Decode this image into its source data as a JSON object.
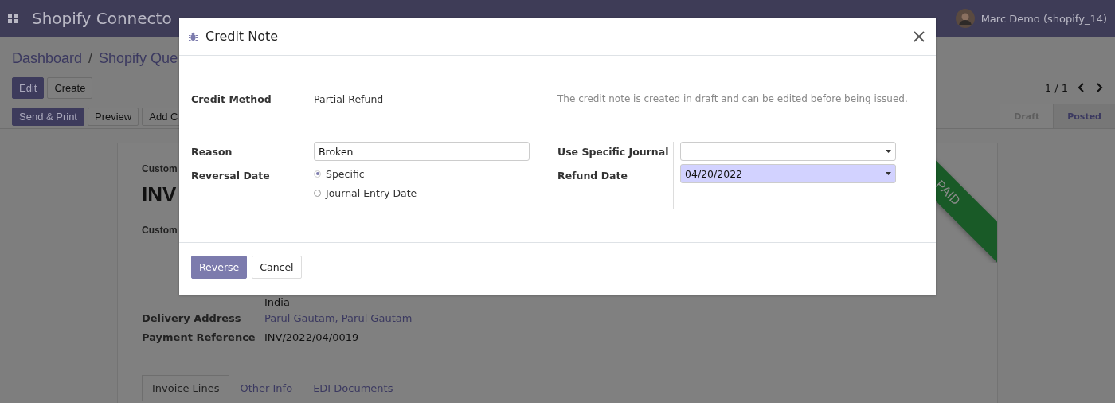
{
  "navbar": {
    "app_title": "Shopify Connecto",
    "user": "Marc Demo (shopify_14)"
  },
  "breadcrumb": {
    "link": "Dashboard",
    "separator": "/",
    "current": "Shopify Que"
  },
  "control_panel": {
    "buttons": [
      {
        "label": "Edit",
        "kind": "primary"
      },
      {
        "label": "Create",
        "kind": "secondary"
      }
    ],
    "pager": "1 / 1"
  },
  "status_bar": {
    "buttons": [
      {
        "label": "Send & Print",
        "kind": "primary"
      },
      {
        "label": "Preview",
        "kind": "secondary"
      },
      {
        "label": "Add C",
        "kind": "secondary"
      }
    ],
    "stages": [
      {
        "label": "Draft",
        "selected": false
      },
      {
        "label": "Posted",
        "selected": true
      }
    ]
  },
  "sheet": {
    "partner_label": "Custom",
    "title": "INV",
    "customer_label": "Custom",
    "address_line": "India",
    "fields": [
      {
        "label": "Delivery Address",
        "value": "Parul Gautam, Parul Gautam",
        "kind": "link"
      },
      {
        "label": "Payment Reference",
        "value": "INV/2022/04/0019",
        "kind": "text"
      }
    ],
    "ribbon": "PAID",
    "tabs": [
      {
        "label": "Invoice Lines",
        "selected": true
      },
      {
        "label": "Other Info",
        "selected": false
      },
      {
        "label": "EDI Documents",
        "selected": false
      }
    ]
  },
  "dialog": {
    "title": "Credit Note",
    "credit_method": {
      "label": "Credit Method",
      "value": "Partial Refund"
    },
    "help": "The credit note is created in draft and can be edited before being issued.",
    "reason": {
      "label": "Reason",
      "value": "Broken"
    },
    "reversal_date": {
      "label": "Reversal Date",
      "options": [
        {
          "label": "Specific",
          "selected": true
        },
        {
          "label": "Journal Entry Date",
          "selected": false
        }
      ]
    },
    "journal": {
      "label": "Use Specific Journal",
      "required": false
    },
    "refund_date": {
      "label": "Refund Date",
      "value": "04/20/2022",
      "required": true
    },
    "buttons": [
      {
        "label": "Reverse",
        "kind": "primary"
      },
      {
        "label": "Cancel",
        "kind": "secondary"
      }
    ]
  }
}
